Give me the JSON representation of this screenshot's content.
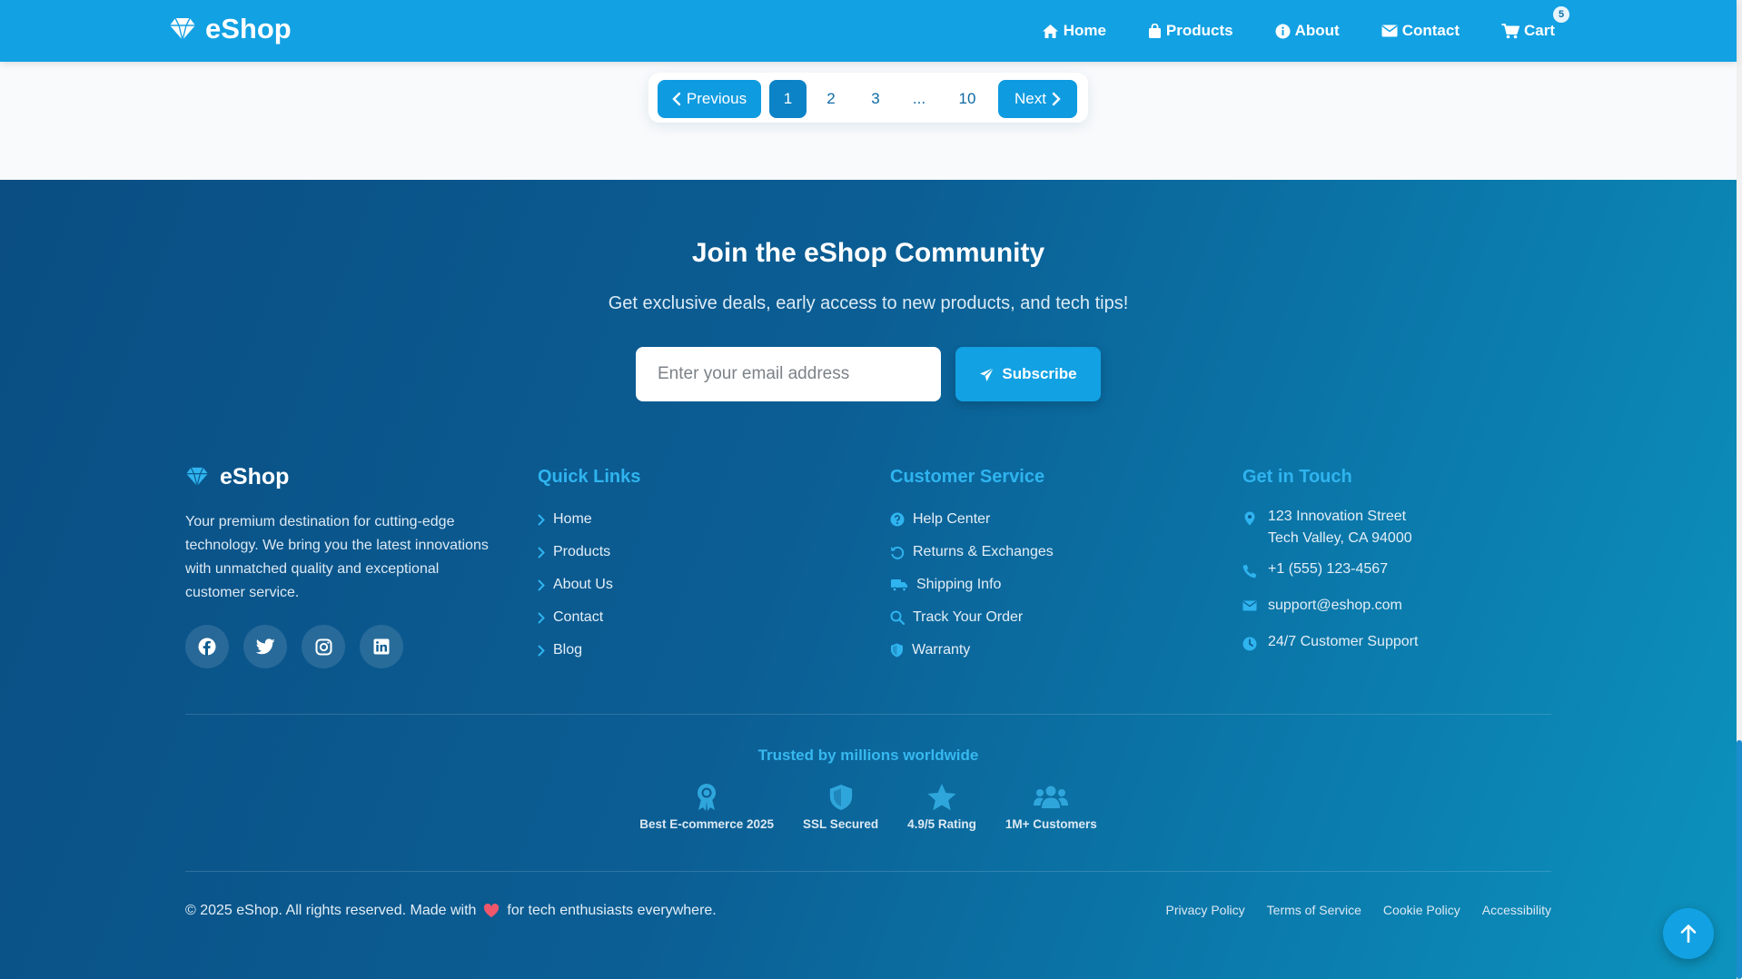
{
  "header": {
    "brand": "eShop",
    "nav": [
      {
        "label": "Home",
        "icon": "home-icon"
      },
      {
        "label": "Products",
        "icon": "shopping-bag-icon"
      },
      {
        "label": "About",
        "icon": "info-icon"
      },
      {
        "label": "Contact",
        "icon": "envelope-icon"
      },
      {
        "label": "Cart",
        "icon": "cart-icon"
      }
    ],
    "cart_count": "5"
  },
  "pagination": {
    "previous": "Previous",
    "pages": [
      "1",
      "2",
      "3",
      "...",
      "10"
    ],
    "active_page": "1",
    "next": "Next"
  },
  "newsletter": {
    "title": "Join the eShop Community",
    "subtitle": "Get exclusive deals, early access to new products, and tech tips!",
    "placeholder": "Enter your email address",
    "button": "Subscribe"
  },
  "footer": {
    "brand": "eShop",
    "description": "Your premium destination for cutting-edge technology. We bring you the latest innovations with unmatched quality and exceptional customer service.",
    "socials": [
      "facebook-icon",
      "twitter-icon",
      "instagram-icon",
      "linkedin-icon"
    ],
    "quick_links": {
      "title": "Quick Links",
      "items": [
        "Home",
        "Products",
        "About Us",
        "Contact",
        "Blog"
      ]
    },
    "customer_service": {
      "title": "Customer Service",
      "items": [
        {
          "label": "Help Center",
          "icon": "question-circle-icon"
        },
        {
          "label": "Returns & Exchanges",
          "icon": "undo-icon"
        },
        {
          "label": "Shipping Info",
          "icon": "truck-icon"
        },
        {
          "label": "Track Your Order",
          "icon": "search-icon"
        },
        {
          "label": "Warranty",
          "icon": "shield-icon"
        }
      ]
    },
    "contact": {
      "title": "Get in Touch",
      "address_line1": "123 Innovation Street",
      "address_line2": "Tech Valley, CA 94000",
      "phone": "+1 (555) 123-4567",
      "email": "support@eshop.com",
      "support": "24/7 Customer Support"
    },
    "trust": {
      "title": "Trusted by millions worldwide",
      "badges": [
        {
          "label": "Best E-commerce 2025",
          "icon": "award-icon"
        },
        {
          "label": "SSL Secured",
          "icon": "shield-icon"
        },
        {
          "label": "4.9/5 Rating",
          "icon": "star-icon"
        },
        {
          "label": "1M+ Customers",
          "icon": "users-icon"
        }
      ]
    },
    "copyright_before": "© 2025 eShop. All rights reserved. Made with",
    "copyright_after": "for tech enthusiasts everywhere.",
    "legal": [
      "Privacy Policy",
      "Terms of Service",
      "Cookie Policy",
      "Accessibility"
    ]
  },
  "colors": {
    "primary": "#12a1e3",
    "footer_dark": "#0a4e83",
    "accent_heading": "#2fb4ef",
    "heart": "#f0576b"
  }
}
